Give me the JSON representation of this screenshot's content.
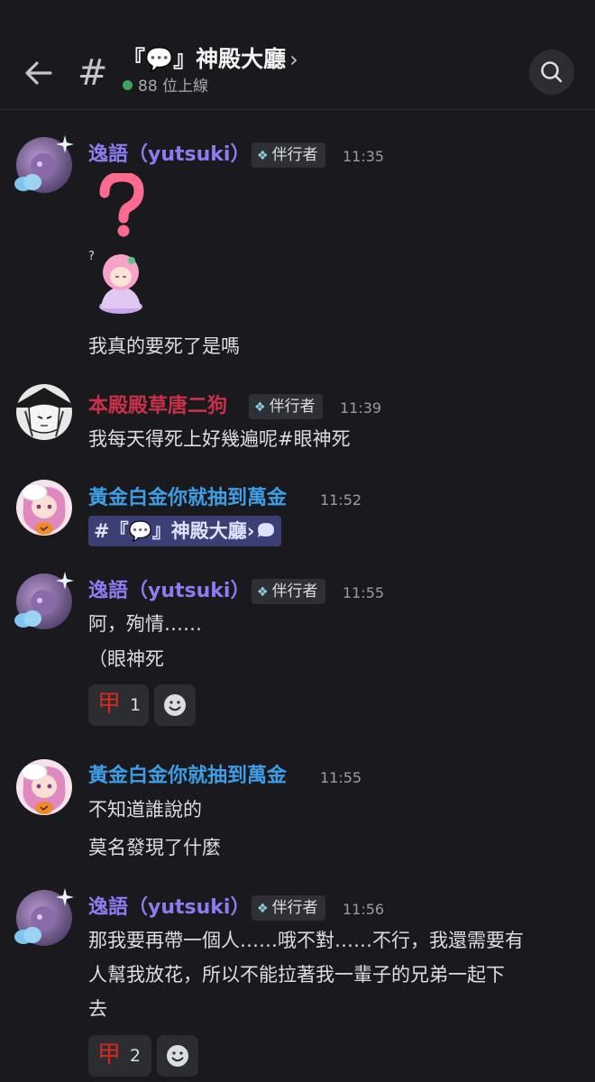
{
  "header": {
    "channel_title": "『💬』神殿大廳",
    "online_text": "88 位上線"
  },
  "messages": [
    {
      "author": "逸語（yutsuki）",
      "tag": "伴行者",
      "time": "11:35",
      "lines": [
        "我真的要死了是嗎"
      ]
    },
    {
      "author": "本殿殿草唐二狗",
      "tag": "伴行者",
      "time": "11:39",
      "lines": [
        "我每天得死上好幾遍呢#眼神死"
      ]
    },
    {
      "author": "黃金白金你就抽到萬金",
      "time": "11:52",
      "channel_mention": "#『💬』神殿大廳›"
    },
    {
      "author": "逸語（yutsuki）",
      "tag": "伴行者",
      "time": "11:55",
      "lines": [
        "阿，殉情……",
        "（眼神死"
      ],
      "reaction": {
        "emoji": "甲",
        "count": "1"
      }
    },
    {
      "author": "黃金白金你就抽到萬金",
      "time": "11:55",
      "lines": [
        "不知道誰說的",
        "莫名發現了什麼"
      ]
    },
    {
      "author": "逸語（yutsuki）",
      "tag": "伴行者",
      "time": "11:56",
      "lines": [
        "那我要再帶一個人……哦不對……不行，我還需要有",
        "人幫我放花，所以不能拉著我一輩子的兄弟一起下",
        "去"
      ],
      "reaction": {
        "emoji": "甲",
        "count": "2"
      }
    }
  ],
  "colors": {
    "background": "#1a1a1e",
    "author_purple": "#8d7cf0",
    "author_red": "#c9304a",
    "author_blue": "#3d9ee6",
    "mention_bg": "#3b3f74",
    "online_green": "#3ba55d"
  },
  "icons": [
    "back-arrow-icon",
    "hash-icon",
    "chevron-right-icon",
    "search-icon",
    "role-gem-icon",
    "emoji-add-icon",
    "question-mark-sticker",
    "anime-girl-sticker",
    "speech-bubble-icon"
  ]
}
